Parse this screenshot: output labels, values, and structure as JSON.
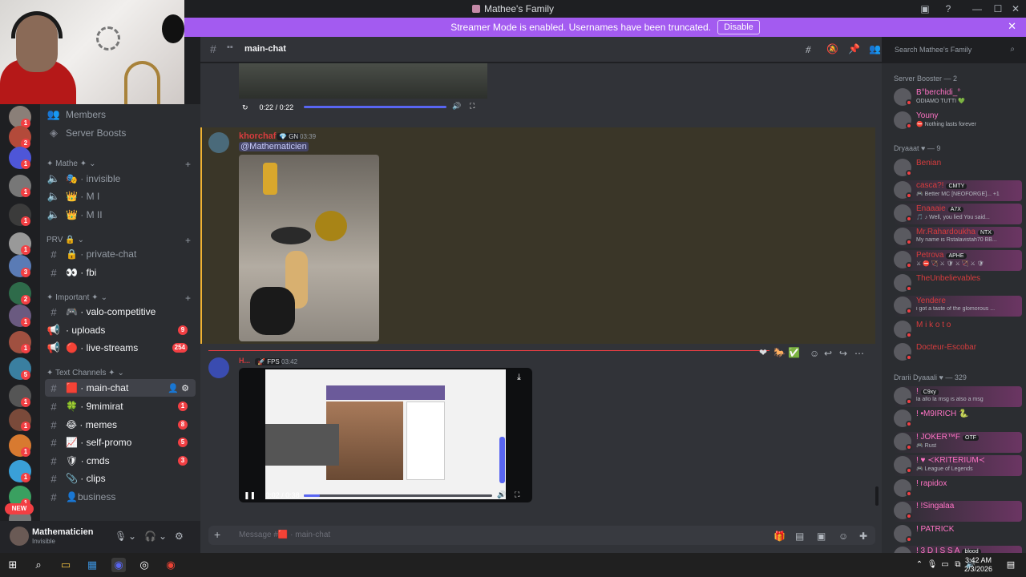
{
  "window": {
    "title": "Mathee's Family"
  },
  "banner": {
    "text": "Streamer Mode is enabled. Usernames have been truncated.",
    "button": "Disable"
  },
  "header": {
    "channel": "main-chat",
    "search_placeholder": "Search Mathee's Family"
  },
  "guild_badges": [
    "1",
    "2",
    "1",
    "1",
    "1",
    "1",
    "3",
    "2",
    "1",
    "1",
    "5",
    "1",
    "1",
    "1",
    "1",
    "1",
    "1"
  ],
  "new_badge": "NEW",
  "sidebar": {
    "top_items": [
      {
        "label": "Members"
      },
      {
        "label": "Server Boosts"
      }
    ],
    "cat_mathe": "✦ Mathe ✦",
    "voice": [
      {
        "label": "invisible"
      },
      {
        "label": "M I"
      },
      {
        "label": "M II"
      }
    ],
    "cat_prv": "PRV 🔒",
    "prv_channels": [
      {
        "label": "private-chat"
      },
      {
        "label": "fbi"
      }
    ],
    "cat_important": "✦ Important ✦",
    "important_channels": [
      {
        "label": "valo-competitive",
        "badge": ""
      },
      {
        "label": "uploads",
        "badge": "9"
      },
      {
        "label": "live-streams",
        "badge": "254"
      }
    ],
    "cat_text": "✦ Text Channels ✦",
    "text_channels": [
      {
        "label": "main-chat",
        "badge": ""
      },
      {
        "label": "9mimirat",
        "badge": "1"
      },
      {
        "label": "memes",
        "badge": "8"
      },
      {
        "label": "self-promo",
        "badge": "5"
      },
      {
        "label": "cmds",
        "badge": "3"
      },
      {
        "label": "clips",
        "badge": ""
      },
      {
        "label": "business",
        "badge": ""
      }
    ]
  },
  "user": {
    "name": "Mathematicien",
    "status": "Invisible"
  },
  "messages": {
    "video1_time": "0:22 / 0:22",
    "msg1": {
      "author": "khorchaf",
      "tag": "GN",
      "time": "03:39",
      "mention": "@Mathematicien"
    },
    "msg2": {
      "author": "H...",
      "tag": "FPS",
      "time": "03:42",
      "video_time": "0:02 / 0:38"
    }
  },
  "composer": {
    "placeholder": "Message #🟥 · main-chat"
  },
  "members": {
    "cat1": "Server Booster — 2",
    "boosters": [
      {
        "name": "B°berchidi_°",
        "sub": "ODIAMO TUTTI 💚"
      },
      {
        "name": "Youny",
        "sub": "⛔ Nothing lasts forever"
      }
    ],
    "cat2": "Dryaaat ♥ — 9",
    "dryaaat": [
      {
        "name": "Benian",
        "tag": "",
        "sub": ""
      },
      {
        "name": "casca?!",
        "tag": "CMTY",
        "sub": "🎮 Better MC [NEOFORGE]... +1"
      },
      {
        "name": "Enaaaie",
        "tag": "A7X",
        "sub": "🎵 ♪ Well, you lied You said..."
      },
      {
        "name": "Mr.Rahardoukha",
        "tag": "NTX",
        "sub": "My name is Rstalavistah70 BB..."
      },
      {
        "name": "Petrova",
        "tag": "APHE",
        "sub": "⚔ ⛔ 🏹 ⚔ 🛡 ⚔ 🏹 ⚔ 🛡"
      },
      {
        "name": "TheUnbelievables",
        "tag": "",
        "sub": ""
      },
      {
        "name": "Yendere",
        "tag": "",
        "sub": "i got a taste of the glomorous ..."
      },
      {
        "name": "M i k o t o",
        "tag": "",
        "sub": ""
      },
      {
        "name": "Docteur-Escobar",
        "tag": "",
        "sub": ""
      }
    ],
    "cat3": "Drarii Dyaaali ♥ — 329",
    "drarii": [
      {
        "name": "!",
        "tag": "C9xy",
        "sub": "la allo la msg is also a msg"
      },
      {
        "name": "! •M9IRICH 🐍",
        "tag": "",
        "sub": ""
      },
      {
        "name": "! JOKER™F",
        "tag": "OTF",
        "sub": "🎮 Rust"
      },
      {
        "name": "! ♥ ≺KRITERIUM≺",
        "tag": "",
        "sub": "🎮 League of Legends"
      },
      {
        "name": "! rapidox",
        "tag": "",
        "sub": ""
      },
      {
        "name": "! !Singalaa",
        "tag": "",
        "sub": ""
      },
      {
        "name": "! PATRICK",
        "tag": "",
        "sub": ""
      },
      {
        "name": "! 3 D I S S A",
        "tag": "blood",
        "sub": ""
      }
    ]
  },
  "taskbar": {
    "time": "3:42 AM",
    "date": "2/3/2026"
  }
}
